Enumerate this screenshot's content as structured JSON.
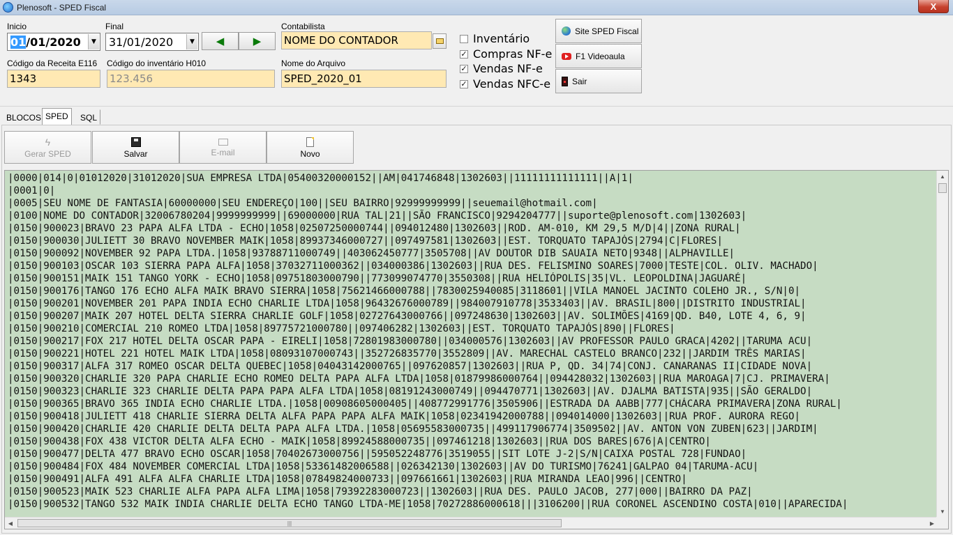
{
  "window": {
    "title": "Plenosoft - SPED Fiscal",
    "close_label": "X"
  },
  "form": {
    "inicio_label": "Inicio",
    "inicio_value_sel": "01",
    "inicio_value_rest": "/01/2020",
    "final_label": "Final",
    "final_value": "31/01/2020",
    "contabilista_label": "Contabilista",
    "contabilista_value": "NOME DO CONTADOR",
    "receita_label": "Código da Receita E116",
    "receita_value": "1343",
    "inventario_label": "Código do inventário H010",
    "inventario_value": "123.456",
    "arquivo_label": "Nome do Arquivo",
    "arquivo_value": "SPED_2020_01"
  },
  "checkboxes": [
    {
      "label": "Inventário",
      "checked": false
    },
    {
      "label": "Compras NF-e",
      "checked": true
    },
    {
      "label": "Vendas NF-e",
      "checked": true
    },
    {
      "label": "Vendas NFC-e",
      "checked": true
    }
  ],
  "side_buttons": {
    "site": "Site SPED Fiscal",
    "video": "F1 Videoaula",
    "exit": "Sair"
  },
  "tabs": [
    "BLOCOS",
    "SPED",
    "SQL"
  ],
  "toolbar": {
    "gerar": "Gerar SPED",
    "salvar": "Salvar",
    "email": "E-mail",
    "novo": "Novo"
  },
  "sped_lines": [
    "|0000|014|0|01012020|31012020|SUA EMPRESA LTDA|05400320000152||AM|041746848|1302603||11111111111111||A|1|",
    "|0001|0|",
    "|0005|SEU NOME DE FANTASIA|60000000|SEU ENDEREÇO|100||SEU BAIRRO|92999999999||seuemail@hotmail.com|",
    "|0100|NOME DO CONTADOR|32006780204|9999999999||69000000|RUA TAL|21||SÃO FRANCISCO|9294204777||suporte@plenosoft.com|1302603|",
    "|0150|900023|BRAVO 23 PAPA ALFA LTDA - ECHO|1058|02507250000744||094012480|1302603||ROD. AM-010, KM 29,5 M/D|4||ZONA RURAL|",
    "|0150|900030|JULIETT 30 BRAVO NOVEMBER MAIK|1058|89937346000727||097497581|1302603||EST. TORQUATO TAPAJÓS|2794|C|FLORES|",
    "|0150|900092|NOVEMBER 92 PAPA LTDA.|1058|93788711000749||403062450777|3505708||AV DOUTOR DIB SAUAIA NETO|9348||ALPHAVILLE|",
    "|0150|900103|OSCAR 103 SIERRA PAPA ALFA|1058|37032711000362||034000386|1302603||RUA DES. FELISMINO SOARES|7000|TESTE|COL. OLIV. MACHADO|",
    "|0150|900151|MAIK 151 TANGO YORK - ECHO|1058|09751803000790||773099074770|3550308||RUA HELIÓPOLIS|35|VL. LEOPOLDINA|JAGUARÉ|",
    "|0150|900176|TANGO 176 ECHO ALFA MAIK BRAVO SIERRA|1058|75621466000788||7830025940085|3118601||VILA MANOEL JACINTO COLEHO JR., S/N|0|",
    "|0150|900201|NOVEMBER 201 PAPA INDIA ECHO CHARLIE LTDA|1058|96432676000789||984007910778|3533403||AV. BRASIL|800||DISTRITO INDUSTRIAL|",
    "|0150|900207|MAIK 207 HOTEL DELTA SIERRA CHARLIE GOLF|1058|02727643000766||097248630|1302603||AV. SOLIMÕES|4169|QD. B40, LOTE 4, 6, 9|",
    "|0150|900210|COMERCIAL 210 ROMEO LTDA|1058|89775721000780||097406282|1302603||EST. TORQUATO TAPAJÓS|890||FLORES|",
    "|0150|900217|FOX 217 HOTEL DELTA OSCAR PAPA - EIRELI|1058|72801983000780||034000576|1302603||AV PROFESSOR PAULO GRACA|4202||TARUMA ACU|",
    "|0150|900221|HOTEL 221 HOTEL MAIK LTDA|1058|08093107000743||352726835770|3552809||AV. MARECHAL CASTELO BRANCO|232||JARDIM TRÊS MARIAS|",
    "|0150|900317|ALFA 317 ROMEO OSCAR DELTA QUEBEC|1058|04043142000765||097620857|1302603||RUA P, QD. 34|74|CONJ. CANARANAS II|CIDADE NOVA|",
    "|0150|900320|CHARLIE 320 PAPA CHARLIE ECHO ROMEO DELTA PAPA ALFA LTDA|1058|01879986000764||094428032|1302603||RUA MAROAGA|7|CJ. PRIMAVERA|",
    "|0150|900323|CHARLIE 323 CHARLIE DELTA PAPA PAPA ALFA LTDA|1058|08191243000749||094470771|1302603||AV. DJALMA BATISTA|935||SÃO GERALDO|",
    "|0150|900365|BRAVO 365 INDIA ECHO CHARLIE LTDA.|1058|00908605000405||408772991776|3505906||ESTRADA DA AABB|777|CHÁCARA PRIMAVERA|ZONA RURAL|",
    "|0150|900418|JULIETT 418 CHARLIE SIERRA DELTA ALFA PAPA PAPA ALFA MAIK|1058|02341942000788||094014000|1302603||RUA PROF. AURORA REGO|",
    "|0150|900420|CHARLIE 420 CHARLIE DELTA DELTA PAPA ALFA LTDA.|1058|05695583000735||499117906774|3509502||AV. ANTON VON ZUBEN|623||JARDIM|",
    "|0150|900438|FOX 438 VICTOR DELTA ALFA ECHO - MAIK|1058|89924588000735||097461218|1302603||RUA DOS BARES|676|A|CENTRO|",
    "|0150|900477|DELTA 477 BRAVO ECHO OSCAR|1058|70402673000756||595052248776|3519055||SIT LOTE J-2|S/N|CAIXA POSTAL 728|FUNDAO|",
    "|0150|900484|FOX 484 NOVEMBER COMERCIAL LTDA|1058|53361482006588||026342130|1302603||AV DO TURISMO|76241|GALPAO 04|TARUMA-ACU|",
    "|0150|900491|ALFA 491 ALFA ALFA CHARLIE LTDA|1058|07849824000733||097661661|1302603||RUA MIRANDA LEAO|996||CENTRO|",
    "|0150|900523|MAIK 523 CHARLIE ALFA PAPA ALFA LIMA|1058|79392283000723||1302603||RUA DES. PAULO JACOB, 277|000||BAIRRO DA PAZ|",
    "|0150|900532|TANGO 532 MAIK INDIA CHARLIE DELTA ECHO TANGO LTDA-ME|1058|70272886000618|||3106200||RUA CORONEL ASCENDINO COSTA|010||APARECIDA|"
  ]
}
